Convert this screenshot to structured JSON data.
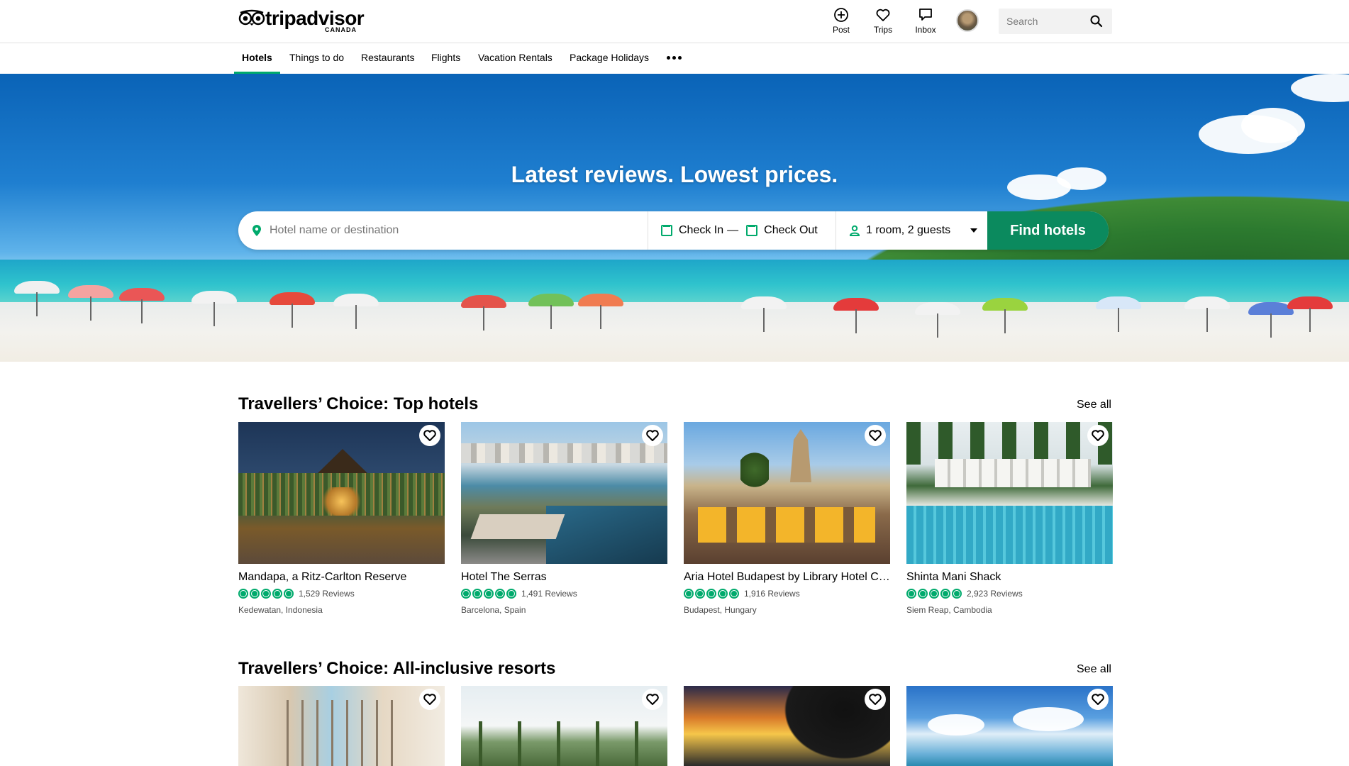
{
  "header": {
    "logo_text": "tripadvisor",
    "logo_sub": "CANADA",
    "post_label": "Post",
    "trips_label": "Trips",
    "inbox_label": "Inbox",
    "search_placeholder": "Search"
  },
  "nav": {
    "items": [
      {
        "label": "Hotels",
        "active": true
      },
      {
        "label": "Things to do",
        "active": false
      },
      {
        "label": "Restaurants",
        "active": false
      },
      {
        "label": "Flights",
        "active": false
      },
      {
        "label": "Vacation Rentals",
        "active": false
      },
      {
        "label": "Package Holidays",
        "active": false
      }
    ],
    "more_icon": "more-dots-icon"
  },
  "hero": {
    "title": "Latest reviews. Lowest prices.",
    "destination_placeholder": "Hotel name or destination",
    "check_in": "Check In",
    "separator": "—",
    "check_out": "Check Out",
    "guests": "1 room, 2 guests",
    "find_button": "Find hotels"
  },
  "sections": {
    "top_hotels": {
      "title": "Travellers’ Choice: Top hotels",
      "see_all": "See all",
      "cards": [
        {
          "name": "Mandapa, a Ritz-Carlton Reserve",
          "reviews": "1,529 Reviews",
          "location": "Kedewatan, Indonesia",
          "rating": 5
        },
        {
          "name": "Hotel The Serras",
          "reviews": "1,491 Reviews",
          "location": "Barcelona, Spain",
          "rating": 5
        },
        {
          "name": "Aria Hotel Budapest by Library Hotel Collection",
          "reviews": "1,916 Reviews",
          "location": "Budapest, Hungary",
          "rating": 5
        },
        {
          "name": "Shinta Mani Shack",
          "reviews": "2,923 Reviews",
          "location": "Siem Reap, Cambodia",
          "rating": 5
        }
      ]
    },
    "resorts": {
      "title": "Travellers’ Choice: All-inclusive resorts",
      "see_all": "See all"
    }
  },
  "colors": {
    "brand_green": "#00aa6c",
    "button_green": "#0b8a5e"
  }
}
